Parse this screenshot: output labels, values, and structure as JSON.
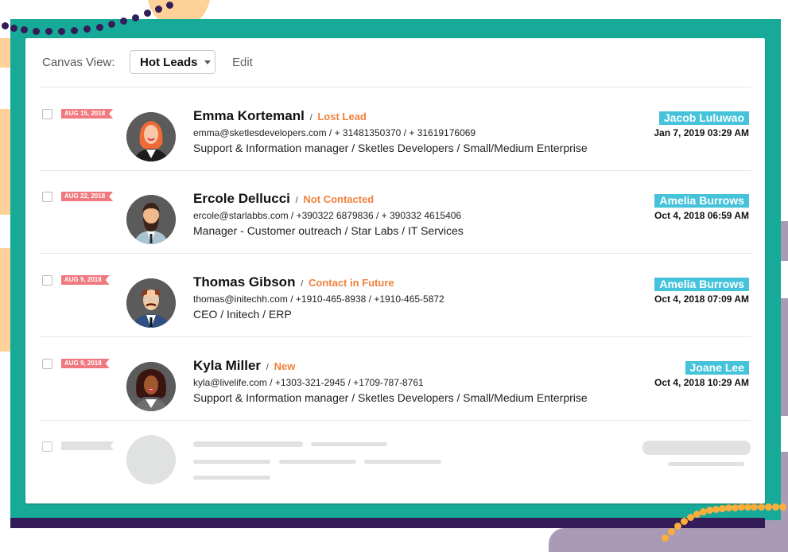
{
  "toolbar": {
    "canvas_label": "Canvas View:",
    "view_selected": "Hot Leads",
    "edit_label": "Edit"
  },
  "leads": [
    {
      "date_tag": "AUG 15, 2018",
      "name": "Emma Kortemanl",
      "status": "Lost Lead",
      "contact": "emma@sketlesdevelopers.com / + 31481350370 / + 31619176069",
      "role": "Support & Information manager / Sketles Developers / Small/Medium Enterprise",
      "owner": "Jacob Luluwao",
      "timestamp": "Jan 7, 2019 03:29 AM",
      "avatar": "avatar-red-hair-woman"
    },
    {
      "date_tag": "AUG 22, 2018",
      "name": "Ercole Dellucci",
      "status": "Not Contacted",
      "contact": "ercole@starlabbs.com / +390322 6879836 / + 390332 4615406",
      "role": "Manager - Customer outreach / Star Labs / IT Services",
      "owner": "Amelia Burrows",
      "timestamp": "Oct 4, 2018 06:59 AM",
      "avatar": "avatar-bearded-man"
    },
    {
      "date_tag": "AUG 9, 2018",
      "name": "Thomas Gibson",
      "status": "Contact in Future",
      "contact": "thomas@initechh.com / +1910-465-8938 / +1910-465-5872",
      "role": "CEO / Initech / ERP",
      "owner": "Amelia Burrows",
      "timestamp": "Oct 4, 2018 07:09 AM",
      "avatar": "avatar-glasses-man"
    },
    {
      "date_tag": "AUG 9, 2018",
      "name": "Kyla Miller",
      "status": "New",
      "contact": "kyla@livelife.com / +1303-321-2945 / +1709-787-8761",
      "role": "Support & Information manager / Sketles Developers / Small/Medium Enterprise",
      "owner": "Joane Lee",
      "timestamp": "Oct 4, 2018 10:29 AM",
      "avatar": "avatar-curly-hair-woman"
    }
  ],
  "colors": {
    "frame_teal": "#18aa98",
    "date_tag": "#f0787f",
    "status_orange": "#f0823c",
    "owner_badge": "#45c3da",
    "accent_navy": "#331c58",
    "accent_peach": "#fdd198",
    "accent_purple": "#a99bb5"
  }
}
